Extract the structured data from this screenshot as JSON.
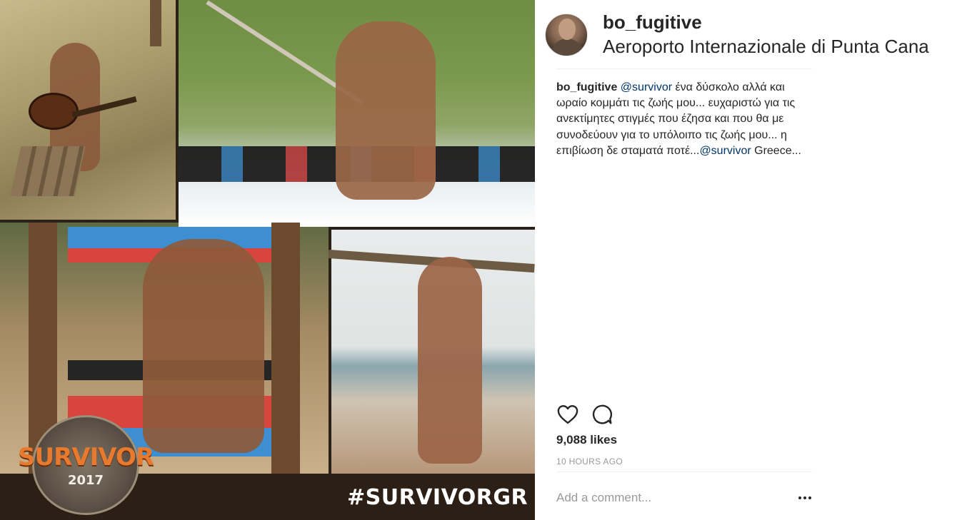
{
  "post": {
    "username": "bo_fugitive",
    "location": "Aeroporto Internazionale di Punta Cana",
    "caption": {
      "username": "bo_fugitive",
      "mention_1": "@survivor",
      "text_1": " ένα δύσκολο αλλά και ωραίο κομμάτι τις ζωής μου... ευχαριστώ για τις ανεκτίμητες στιγμές που έζησα και που θα με συνοδεύουν για το υπόλοιπο τις ζωής μου... η επιβίωση δε σταματά ποτέ...",
      "mention_2": "@survivor",
      "text_2": " Greece..."
    },
    "likes": "9,088 likes",
    "time": "10 HOURS AGO",
    "comment_placeholder": "Add a comment..."
  },
  "photo": {
    "logo_text": "SURVIVOR",
    "logo_year": "2017",
    "hashtag": "#SURVIVORGR"
  },
  "icons": {
    "like": "heart-icon",
    "comment": "comment-bubble-icon",
    "more": "more-options-icon"
  },
  "colors": {
    "mention": "#003569",
    "text": "#262626",
    "muted": "#999999",
    "divider": "#efefef"
  }
}
